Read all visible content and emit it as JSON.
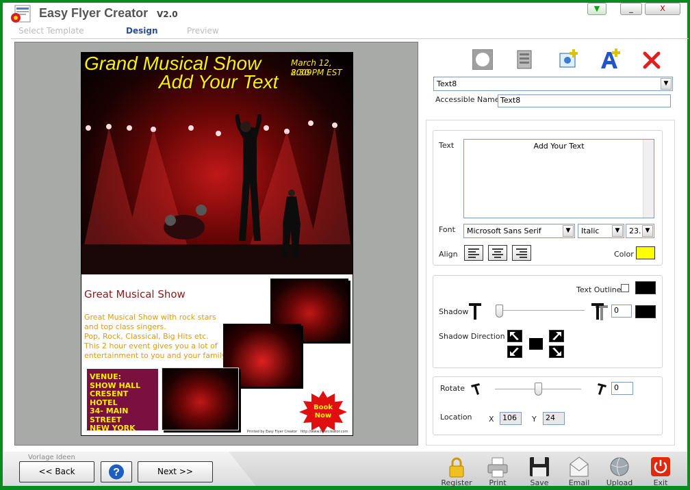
{
  "app": {
    "title": "Easy Flyer Creator",
    "version": "V2.0",
    "icon": "flyer-app-icon"
  },
  "window": {
    "minimize": "_",
    "close": "X",
    "menu": "▼"
  },
  "steps": [
    {
      "label": "Select Template",
      "active": false
    },
    {
      "label": "Design",
      "active": true
    },
    {
      "label": "Preview",
      "active": false
    }
  ],
  "flyer": {
    "title1": "Grand Musical Show",
    "title2": "Add Your Text",
    "date": "March 12, 2009",
    "time": "8:30 PM EST",
    "subtitle": "Great Musical Show",
    "desc": [
      "Great Musical Show with rock stars",
      "and top class singers.",
      "Pop, Rock, Classical, Big Hits etc.",
      "This 2 hour event gives you a lot of",
      "entertainment to you and your family."
    ],
    "venue": [
      "VENUE:",
      "SHOW HALL",
      "CRESENT HOTEL",
      "34- MAIN STREET",
      "NEW YORK"
    ],
    "book": [
      "Book",
      "Now"
    ],
    "footer_left": "Printed by Easy Flyer Creator",
    "footer_right": "http://www.flyercreator.com",
    "colors": {
      "title": "#ffee00",
      "subtitle": "#8b1a1a",
      "desc": "#e09a10",
      "venue_bg": "#7a1040",
      "venue_text": "#ffee00",
      "book_bg": "#e01010",
      "book_text": "#ffee00"
    }
  },
  "panel": {
    "toolbar": [
      "circle-shape-icon",
      "image-tool-icon",
      "add-image-icon",
      "add-text-icon",
      "delete-icon"
    ],
    "element_select": "Text8",
    "accessible_label": "Accessible Name",
    "accessible_value": "Text8",
    "text_label": "Text",
    "text_value": "Add Your Text",
    "font_label": "Font",
    "font_value": "Microsoft Sans Serif",
    "style_value": "Italic",
    "size_value": "23.",
    "align_label": "Align",
    "color_label": "Color",
    "color_value": "#ffff00",
    "outline_label": "Text Outline",
    "outline_checked": false,
    "outline_color": "#000000",
    "shadow_label": "Shadow",
    "shadow_value": "0",
    "shadow_slider": 0,
    "shadow_color": "#000000",
    "shadow_direction_label": "Shadow Direction",
    "rotate_label": "Rotate",
    "rotate_value": "0",
    "rotate_slider": 0.5,
    "location_label": "Location",
    "x_label": "X",
    "x_value": "106",
    "y_label": "Y",
    "y_value": "24"
  },
  "bottom": {
    "tab_label": "Vorlage Ideen",
    "back": "<< Back",
    "next": "Next >>",
    "actions": [
      {
        "label": "Register",
        "icon": "lock-icon"
      },
      {
        "label": "Print",
        "icon": "printer-icon"
      },
      {
        "label": "Save",
        "icon": "floppy-disk-icon"
      },
      {
        "label": "Email",
        "icon": "envelope-icon"
      },
      {
        "label": "Upload",
        "icon": "upload-globe-icon"
      },
      {
        "label": "Exit",
        "icon": "power-icon"
      }
    ]
  }
}
